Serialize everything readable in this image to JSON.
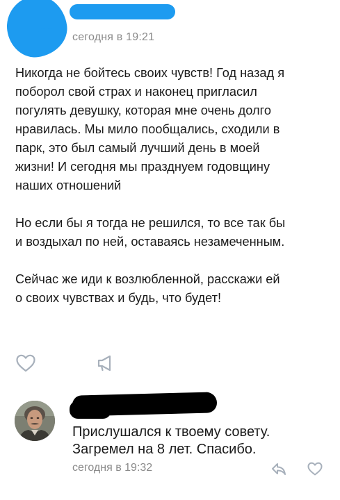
{
  "post": {
    "time": "сегодня в 19:21",
    "paragraphs": [
      [
        "Никогда не бойтесь своих чувств! Год назад я",
        "поборол свой страх и наконец пригласил",
        "погулять девушку, которая мне очень долго",
        "нравилась. Мы мило пообщались, сходили в",
        "парк, это был самый лучший день в моей",
        "жизни! И сегодня мы празднуем годовщину",
        "наших отношений"
      ],
      [
        "Но если бы я тогда не решился, то все так бы",
        "и воздыхал по ней, оставаясь незамеченным."
      ],
      [
        "Сейчас же иди к возлюбленной, расскажи ей",
        "о своих чувствах и будь, что будет!"
      ]
    ],
    "actions": {
      "like_icon": "heart-outline-icon",
      "share_icon": "megaphone-share-icon"
    }
  },
  "comment": {
    "lines": [
      "Прислушался к твоему совету.",
      "Загремел на 8 лет. Спасибо."
    ],
    "time": "сегодня в 19:32",
    "reply_icon": "reply-arrow-icon",
    "like_icon": "heart-outline-icon"
  },
  "colors": {
    "redaction_blue": "#1d9bf0",
    "redaction_black": "#000000",
    "meta_gray": "#8a8a8a",
    "icon_gray": "#a7b0bb"
  }
}
